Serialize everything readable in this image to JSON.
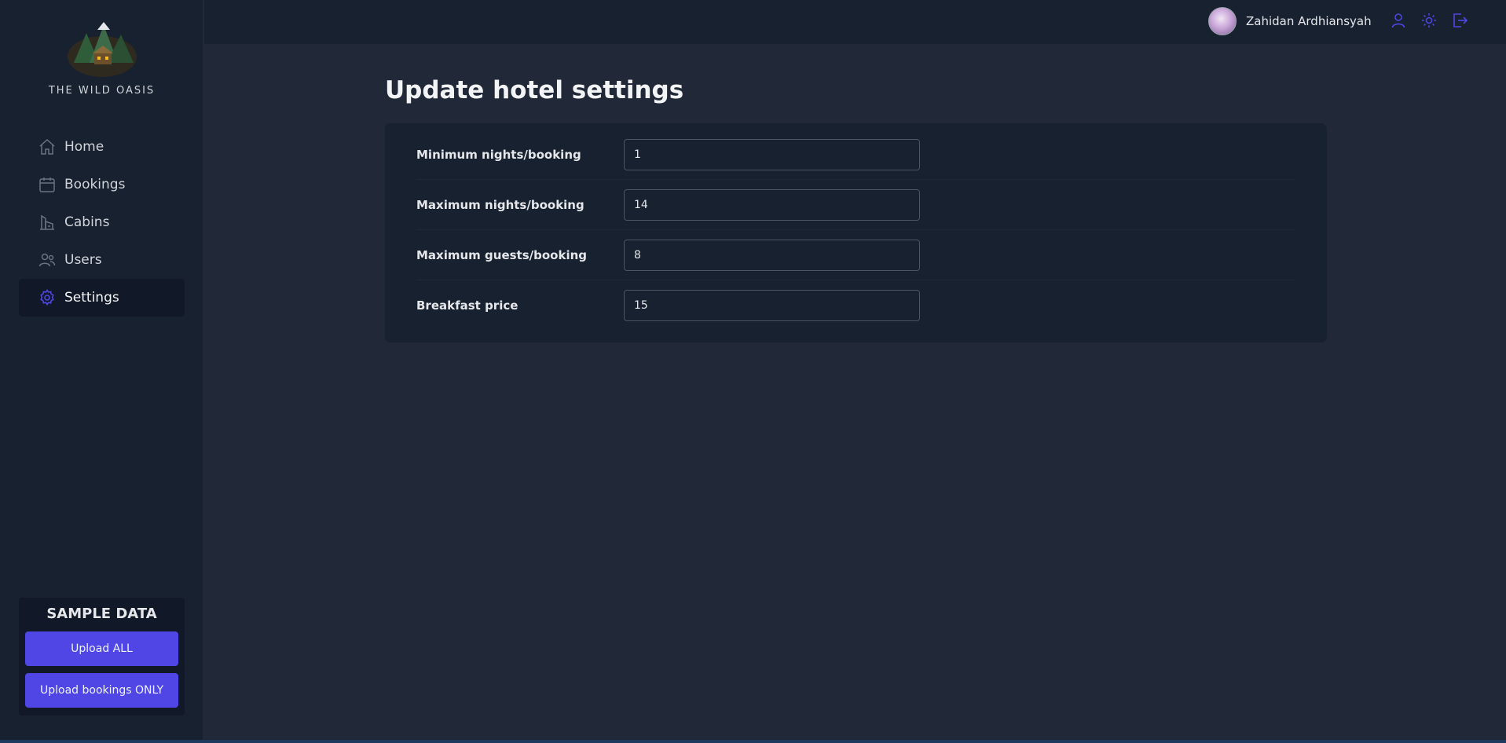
{
  "sidebar": {
    "brand": "THE WILD OASIS",
    "nav": [
      {
        "label": "Home",
        "icon": "home-icon"
      },
      {
        "label": "Bookings",
        "icon": "calendar-icon"
      },
      {
        "label": "Cabins",
        "icon": "building-icon"
      },
      {
        "label": "Users",
        "icon": "users-icon"
      },
      {
        "label": "Settings",
        "icon": "gear-icon",
        "active": true
      }
    ],
    "sample": {
      "title": "SAMPLE DATA",
      "upload_all": "Upload ALL",
      "upload_bookings": "Upload bookings ONLY"
    }
  },
  "header": {
    "user_name": "Zahidan Ardhiansyah",
    "icons": [
      "user-icon",
      "sun-icon",
      "logout-icon"
    ]
  },
  "main": {
    "title": "Update hotel settings",
    "fields": [
      {
        "label": "Minimum nights/booking",
        "value": "1"
      },
      {
        "label": "Maximum nights/booking",
        "value": "14"
      },
      {
        "label": "Maximum guests/booking",
        "value": "8"
      },
      {
        "label": "Breakfast price",
        "value": "15"
      }
    ]
  },
  "colors": {
    "accent": "#4f46e5",
    "background": "#212938",
    "panel": "#18212f"
  }
}
